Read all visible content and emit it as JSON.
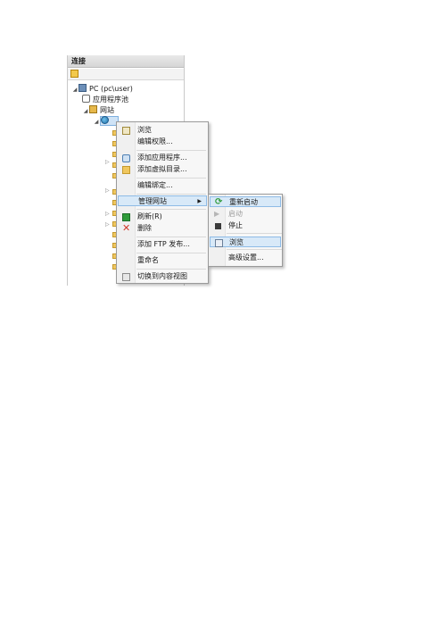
{
  "panel": {
    "title": "连接",
    "tree": {
      "pc_label": "PC (pc\\user)",
      "app_pools_label": "应用程序池",
      "sites_label": "网站",
      "selected_site_label": " "
    }
  },
  "context_menu": {
    "items": [
      {
        "label": "浏览",
        "icon": "browse-icon"
      },
      {
        "label": "编辑权限...",
        "icon": ""
      },
      {
        "label": "添加应用程序...",
        "icon": "add-app-icon"
      },
      {
        "label": "添加虚拟目录...",
        "icon": "add-vdir-icon"
      },
      {
        "label": "编辑绑定...",
        "icon": ""
      },
      {
        "label": "管理网站",
        "icon": "",
        "has_submenu": true
      },
      {
        "label": "刷新(R)",
        "icon": "refresh-icon"
      },
      {
        "label": "删除",
        "icon": "delete-icon"
      },
      {
        "label": "添加 FTP 发布...",
        "icon": ""
      },
      {
        "label": "重命名",
        "icon": ""
      },
      {
        "label": "切换到内容视图",
        "icon": "content-view-icon"
      }
    ]
  },
  "submenu": {
    "items": [
      {
        "label": "重新启动",
        "icon": "restart-icon"
      },
      {
        "label": "启动",
        "icon": "start-icon",
        "disabled": true
      },
      {
        "label": "停止",
        "icon": "stop-icon"
      },
      {
        "label": "浏览",
        "icon": "browse-icon"
      },
      {
        "label": "高级设置...",
        "icon": ""
      }
    ]
  },
  "colors": {
    "highlight": "#d8e9f8",
    "highlight_border": "#8ebbe6",
    "refresh_green": "#2e9b3a",
    "delete_red": "#d23a2a"
  }
}
